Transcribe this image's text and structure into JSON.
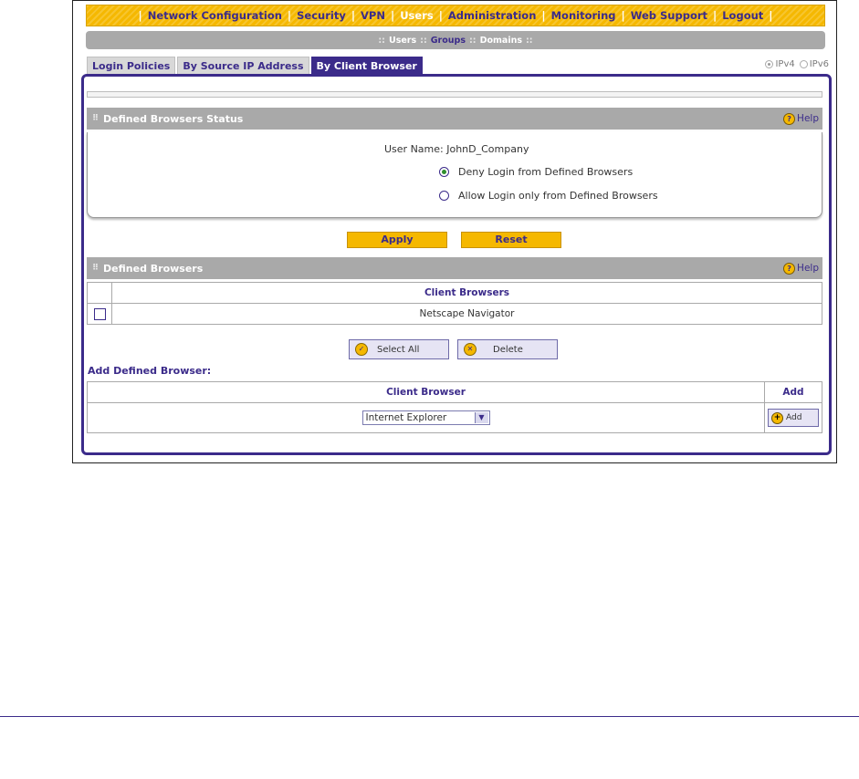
{
  "topnav": {
    "items": [
      "Network Configuration",
      "Security",
      "VPN",
      "Users",
      "Administration",
      "Monitoring",
      "Web Support",
      "Logout"
    ],
    "active_index": 3
  },
  "subnav": {
    "items": [
      "Users",
      "Groups",
      "Domains"
    ],
    "active_index": 1
  },
  "tabs": {
    "items": [
      "Login Policies",
      "By Source IP Address",
      "By Client Browser"
    ],
    "active_index": 2
  },
  "ip_version": {
    "ipv4": "IPv4",
    "ipv6": "IPv6",
    "selected": "IPv4"
  },
  "status_section": {
    "title": "Defined Browsers Status",
    "help": "Help",
    "user_name_label": "User Name:",
    "user_name": "JohnD_Company",
    "option_deny": "Deny Login from Defined Browsers",
    "option_allow": "Allow Login only from Defined Browsers",
    "selected": "deny"
  },
  "buttons": {
    "apply": "Apply",
    "reset": "Reset",
    "select_all": "Select All",
    "delete": "Delete"
  },
  "defined_section": {
    "title": "Defined Browsers",
    "help": "Help",
    "column": "Client Browsers",
    "rows": [
      "Netscape Navigator"
    ]
  },
  "add_section": {
    "label": "Add Defined Browser:",
    "column_browser": "Client Browser",
    "column_add": "Add",
    "select_value": "Internet Explorer",
    "add_button": "Add"
  },
  "colors": {
    "accent": "#3b2b8a",
    "nav_yellow": "#f5b800",
    "header_gray": "#a9a9a9"
  }
}
